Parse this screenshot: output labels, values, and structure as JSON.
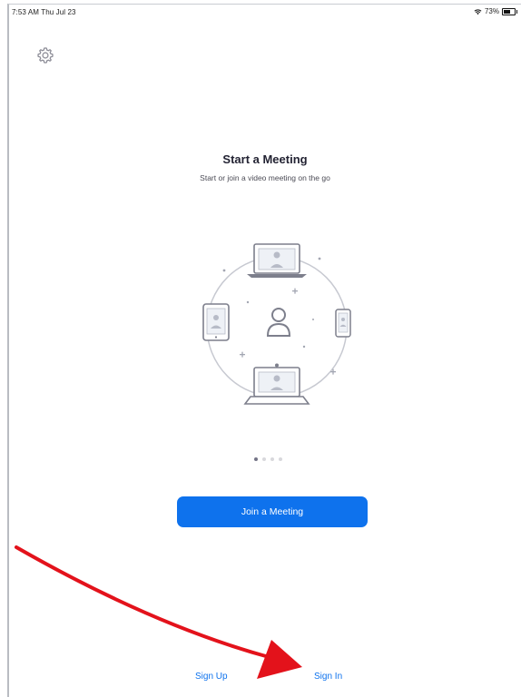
{
  "status_bar": {
    "time_date": "7:53 AM  Thu Jul 23",
    "battery_text": "73%",
    "battery_level": 0.73
  },
  "settings": {
    "icon": "gear-icon"
  },
  "onboarding": {
    "title": "Start a Meeting",
    "subtitle": "Start or join a video meeting on the go",
    "page_indicator": {
      "total": 4,
      "current": 1
    }
  },
  "actions": {
    "join_meeting_label": "Join a Meeting",
    "sign_up_label": "Sign Up",
    "sign_in_label": "Sign In"
  },
  "colors": {
    "accent": "#0e72ed",
    "annotation_arrow": "#e3121b"
  }
}
